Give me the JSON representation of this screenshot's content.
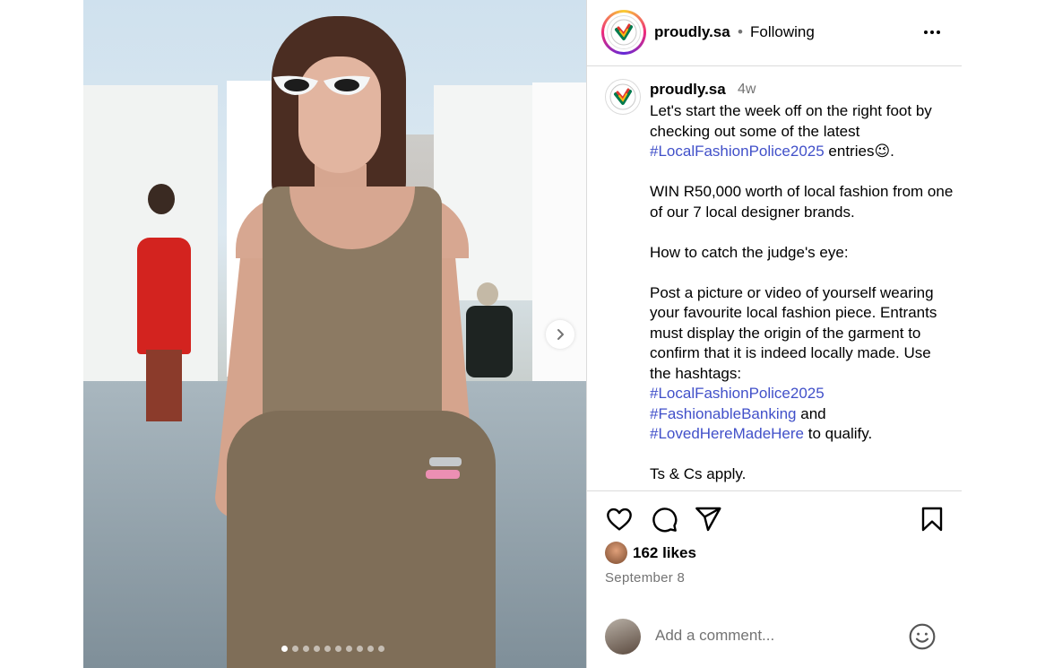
{
  "header": {
    "username": "proudly.sa",
    "separator": "•",
    "follow_status": "Following"
  },
  "caption": {
    "username": "proudly.sa",
    "time": "4w",
    "line1": "Let's start the week off on the right foot by checking out some of the latest ",
    "tag1": "#LocalFashionPolice2025",
    "line1_end": " entries😉.",
    "para2": "WIN R50,000 worth of local fashion from one of our 7 local designer brands.",
    "para3": "How to catch the judge's eye:",
    "para4": "Post a picture or video of yourself wearing your favourite local fashion piece. Entrants must display the origin of the garment to confirm that it is indeed locally made. Use the hashtags:",
    "tag2": "#LocalFashionPolice2025",
    "tag3": "#FashionableBanking",
    "and_text": " and",
    "tag4": "#LovedHereMadeHere",
    "qualify_text": " to qualify.",
    "para5": "Ts & Cs apply."
  },
  "engagement": {
    "likes": "162 likes",
    "date": "September 8"
  },
  "comment": {
    "placeholder": "Add a comment..."
  },
  "carousel": {
    "slide_count": 10,
    "active_index": 0
  },
  "colors": {
    "hashtag": "#4150c9",
    "secondary_text": "#737373",
    "border": "#dbdbdb"
  },
  "icons": {
    "like": "heart-icon",
    "comment": "comment-icon",
    "share": "share-icon",
    "save": "bookmark-icon",
    "emoji": "emoji-icon",
    "next": "chevron-right-icon",
    "more": "more-icon"
  }
}
